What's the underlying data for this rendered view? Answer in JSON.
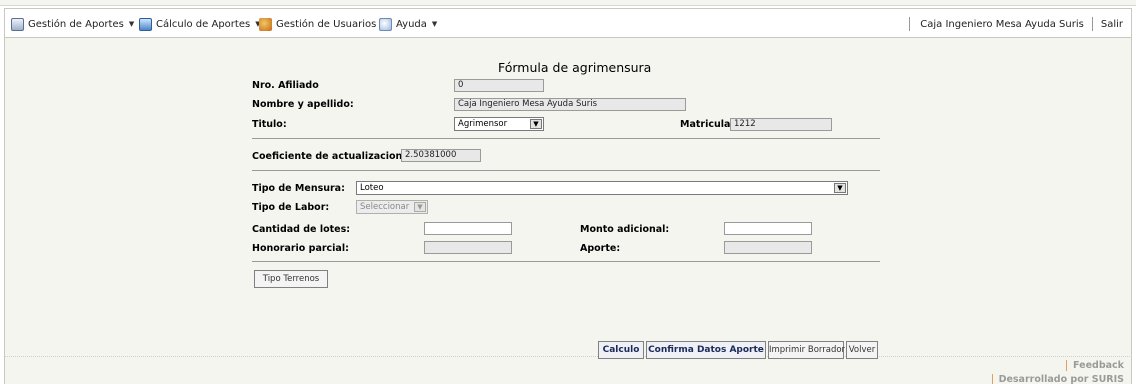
{
  "menu": [
    {
      "label": "Gestión de Aportes",
      "icon": "document-icon"
    },
    {
      "label": "Cálculo de Aportes",
      "icon": "calculator-icon"
    },
    {
      "label": "Gestión de Usuarios",
      "icon": "users-icon"
    },
    {
      "label": "Ayuda",
      "icon": "help-icon"
    }
  ],
  "user": {
    "name": "Caja Ingeniero Mesa Ayuda Suris",
    "logout": "Salir"
  },
  "form": {
    "title": "Fórmula de agrimensura",
    "afiliado_label": "Nro. Afiliado",
    "afiliado_value": "0",
    "nombre_label": "Nombre y apellido:",
    "nombre_value": "Caja Ingeniero Mesa Ayuda Suris",
    "titulo_label": "Titulo:",
    "titulo_value": "Agrimensor",
    "matricula_label": "Matricula",
    "matricula_value": "1212",
    "coef_label": "Coeficiente de actualizacion:",
    "coef_value": "2.50381000",
    "tipo_mensura_label": "Tipo de Mensura:",
    "tipo_mensura_value": "Loteo",
    "tipo_labor_label": "Tipo de Labor:",
    "tipo_labor_value": "Seleccionar",
    "cantidad_lotes_label": "Cantidad de lotes:",
    "cantidad_lotes_value": "",
    "monto_adicional_label": "Monto adicional:",
    "monto_adicional_value": "",
    "honorario_label": "Honorario parcial:",
    "honorario_value": "",
    "aporte_label": "Aporte:",
    "aporte_value": "",
    "tipo_terrenos_button": "Tipo Terrenos"
  },
  "actions": {
    "calculo": "Calculo",
    "confirma": "Confirma Datos Aporte",
    "imprimir": "Imprimir Borrador",
    "volver": "Volver"
  },
  "footer": {
    "feedback": "Feedback",
    "developed": "Desarrollado por SURIS"
  }
}
